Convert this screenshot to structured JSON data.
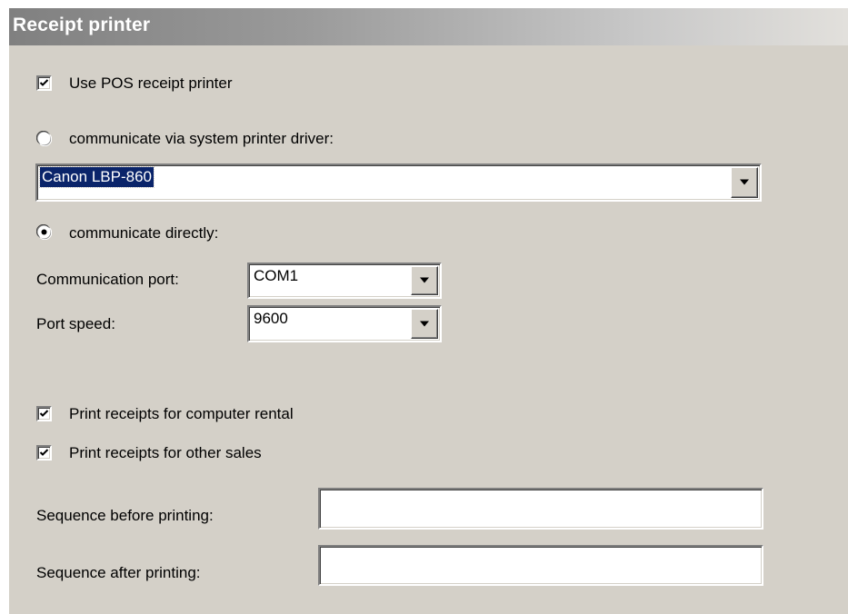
{
  "header": {
    "title": "Receipt printer"
  },
  "use_pos": {
    "label": "Use POS receipt printer",
    "checked": true
  },
  "mode": {
    "system_driver_label": "communicate via system printer driver:",
    "direct_label": "communicate directly:",
    "selected": "direct"
  },
  "printer_driver": {
    "value": "Canon LBP-860"
  },
  "comm_port": {
    "label": "Communication port:",
    "value": "COM1"
  },
  "port_speed": {
    "label": "Port speed:",
    "value": "9600"
  },
  "print_rental": {
    "label": "Print receipts for computer rental",
    "checked": true
  },
  "print_other": {
    "label": "Print receipts for other sales",
    "checked": true
  },
  "seq_before": {
    "label": "Sequence before printing:",
    "value": ""
  },
  "seq_after": {
    "label": "Sequence after printing:",
    "value": ""
  },
  "colors": {
    "panel_bg": "#d4d0c8",
    "selection": "#0a246a",
    "header_text": "#ffffff"
  }
}
